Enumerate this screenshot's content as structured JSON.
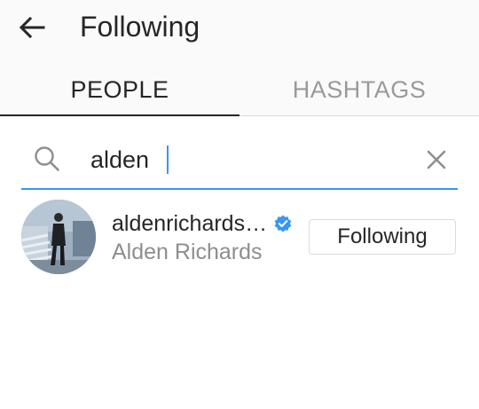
{
  "header": {
    "title": "Following",
    "back_icon": "arrow-left-icon"
  },
  "tabs": [
    {
      "label": "PEOPLE",
      "active": true
    },
    {
      "label": "HASHTAGS",
      "active": false
    }
  ],
  "search": {
    "value": "alden",
    "search_icon": "search-icon",
    "clear_icon": "close-icon"
  },
  "results": [
    {
      "username": "aldenrichards…",
      "verified": true,
      "full_name": "Alden Richards",
      "button_label": "Following"
    }
  ],
  "colors": {
    "accent": "#3897f0",
    "text_primary": "#262626",
    "text_secondary": "#8e8e8e",
    "tab_inactive": "#9a9a9a",
    "header_bg": "#fafafa"
  }
}
